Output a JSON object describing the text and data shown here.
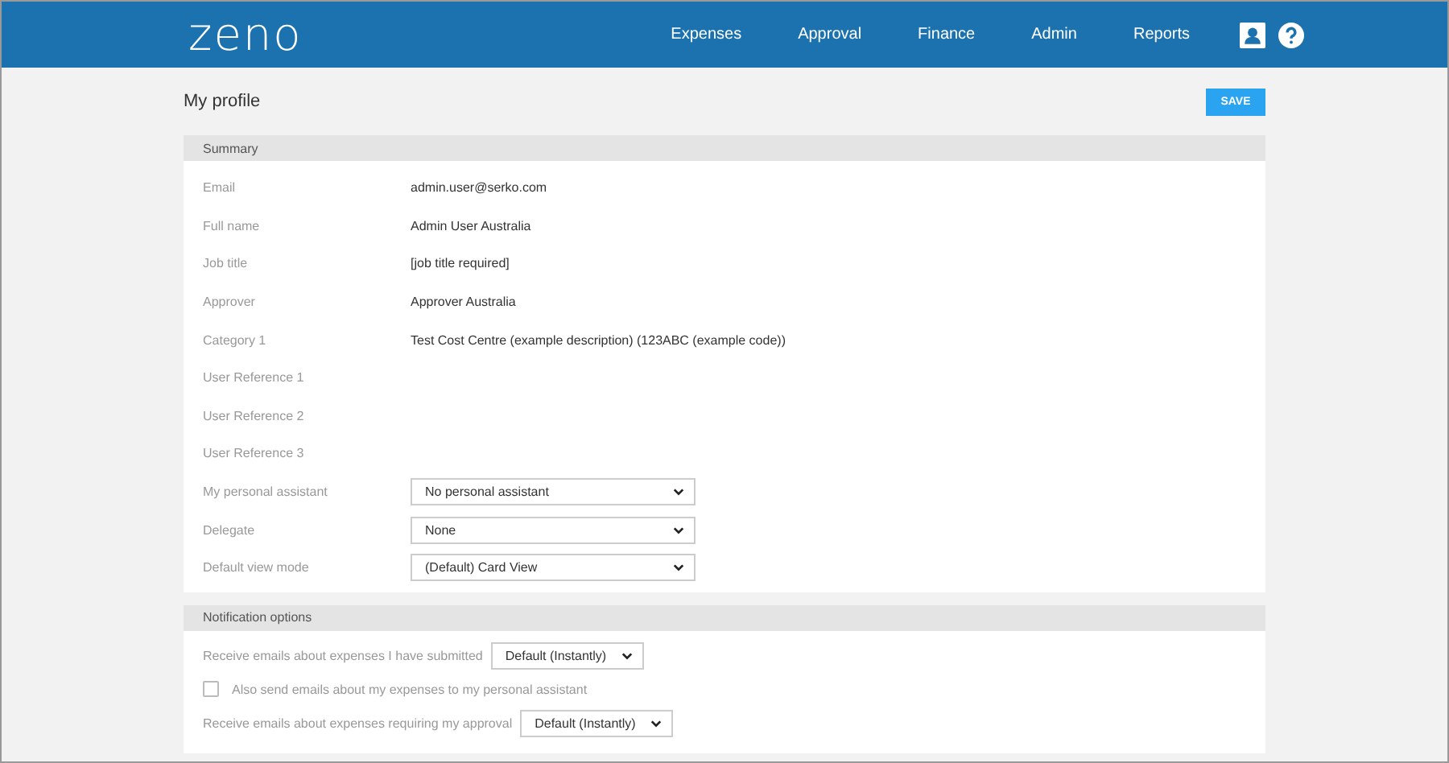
{
  "header": {
    "logo": "zeno",
    "nav": [
      {
        "label": "Expenses"
      },
      {
        "label": "Approval"
      },
      {
        "label": "Finance"
      },
      {
        "label": "Admin"
      },
      {
        "label": "Reports"
      }
    ]
  },
  "page": {
    "title": "My profile",
    "save": "SAVE"
  },
  "summary": {
    "heading": "Summary",
    "rows": [
      {
        "kind": "text",
        "label": "Email",
        "value": "admin.user@serko.com"
      },
      {
        "kind": "text",
        "label": "Full name",
        "value": "Admin User Australia"
      },
      {
        "kind": "text",
        "label": "Job title",
        "value": "[job title required]"
      },
      {
        "kind": "text",
        "label": "Approver",
        "value": "Approver Australia"
      },
      {
        "kind": "text",
        "label": "Category 1",
        "value": "Test Cost Centre (example description) (123ABC (example code))"
      },
      {
        "kind": "text",
        "label": "User Reference 1"
      },
      {
        "kind": "text",
        "label": "User Reference 2"
      },
      {
        "kind": "text",
        "label": "User Reference 3"
      },
      {
        "kind": "select",
        "label": "My personal assistant",
        "value": "No personal assistant"
      },
      {
        "kind": "select",
        "label": "Delegate",
        "value": "None"
      },
      {
        "kind": "select",
        "label": "Default view mode",
        "value": "(Default) Card View"
      }
    ]
  },
  "notifications": {
    "heading": "Notification options",
    "rows": [
      {
        "kind": "select",
        "label": "Receive emails about expenses I have submitted",
        "value": "Default (Instantly)"
      },
      {
        "kind": "checkbox",
        "label": "Also send emails about my expenses to my personal assistant",
        "checked": false
      },
      {
        "kind": "select",
        "label": "Receive emails about expenses requiring my approval",
        "value": "Default (Instantly)"
      }
    ]
  }
}
